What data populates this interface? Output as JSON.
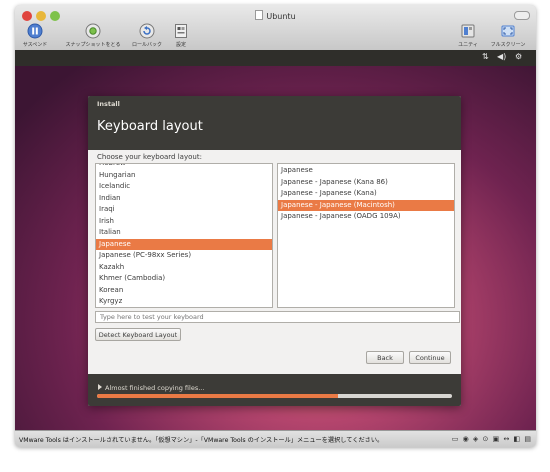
{
  "window": {
    "title": "Ubuntu",
    "toolbar": {
      "suspend_label": "サスペンド",
      "snapshot_label": "スナップショットをとる",
      "rollback_label": "ロールバック",
      "settings_label": "設定",
      "unity_label": "ユニティ",
      "fullscreen_label": "フルスクリーン"
    }
  },
  "installer": {
    "window_title": "Install",
    "page_title": "Keyboard layout",
    "choose_label": "Choose your keyboard layout:",
    "layouts": [
      "Hebrew",
      "Hungarian",
      "Icelandic",
      "Indian",
      "Iraqi",
      "Irish",
      "Italian",
      "Japanese",
      "Japanese (PC-98xx Series)",
      "Kazakh",
      "Khmer (Cambodia)",
      "Korean",
      "Kyrgyz"
    ],
    "selected_layout": "Japanese",
    "variants": [
      "Japanese",
      "Japanese - Japanese (Kana 86)",
      "Japanese - Japanese (Kana)",
      "Japanese - Japanese (Macintosh)",
      "Japanese - Japanese (OADG 109A)"
    ],
    "selected_variant": "Japanese - Japanese (Macintosh)",
    "test_placeholder": "Type here to test your keyboard",
    "detect_button": "Detect Keyboard Layout",
    "back_button": "Back",
    "continue_button": "Continue",
    "progress_label": "Almost finished copying files...",
    "progress_fraction": 0.68
  },
  "status_message": "VMware Tools はインストールされていません。「仮想マシン」-「VMware Tools のインストール」メニューを選択してください。",
  "colors": {
    "accent": "#ea7a45",
    "header": "#3c3b37"
  }
}
